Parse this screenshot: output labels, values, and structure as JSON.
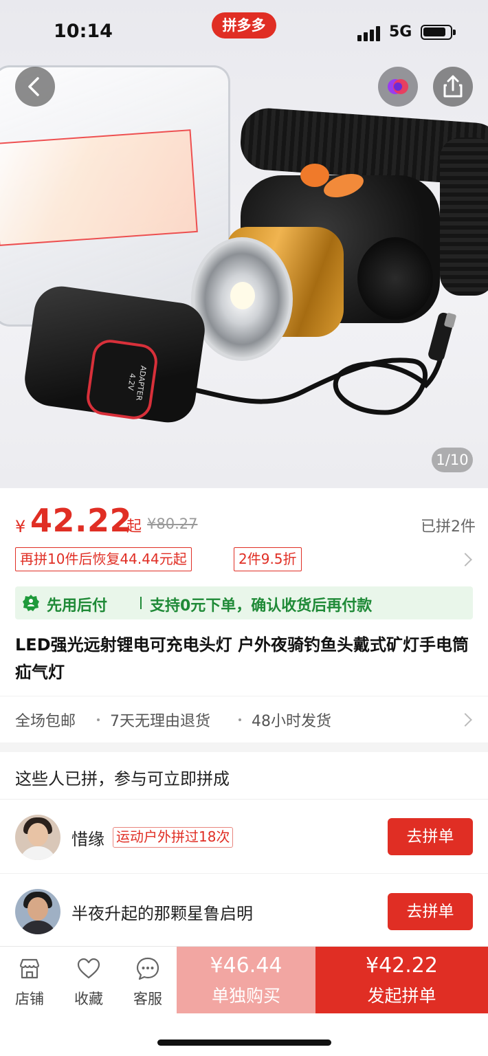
{
  "status_bar": {
    "time": "10:14",
    "network": "5G",
    "brand": "拼多多"
  },
  "hero": {
    "page_counter": "1/10",
    "adapter_text": "ADAPTER 4.2V"
  },
  "price": {
    "currency": "¥",
    "current": "42.22",
    "suffix": "起",
    "original": "¥80.27",
    "sold": "已拼2件"
  },
  "promo_tags": [
    "再拼10件后恢复44.44元起",
    "2件9.5折"
  ],
  "pay_later": {
    "label": "先用后付",
    "description": "支持0元下单，确认收货后再付款",
    "accent_color": "#1f8a37"
  },
  "product_title": "LED强光远射锂电可充电头灯 户外夜骑钓鱼头戴式矿灯手电筒疝气灯",
  "services": [
    "全场包邮",
    "7天无理由退货",
    "48小时发货"
  ],
  "group_buy": {
    "heading": "这些人已拼，参与可立即拼成",
    "members": [
      {
        "name": "惜缘",
        "tag": "运动户外拼过18次",
        "button": "去拼单"
      },
      {
        "name": "半夜升起的那颗星鲁启明",
        "tag": "",
        "button": "去拼单"
      }
    ]
  },
  "bottom_bar": {
    "tabs": [
      {
        "label": "店铺",
        "icon": "store-icon"
      },
      {
        "label": "收藏",
        "icon": "heart-icon"
      },
      {
        "label": "客服",
        "icon": "chat-icon"
      }
    ],
    "buy_alone": {
      "price": "¥46.44",
      "label": "单独购买"
    },
    "buy_group": {
      "price": "¥42.22",
      "label": "发起拼单"
    }
  },
  "colors": {
    "brand_red": "#e02e24",
    "buy_alone_bg": "#f2a6a2"
  }
}
